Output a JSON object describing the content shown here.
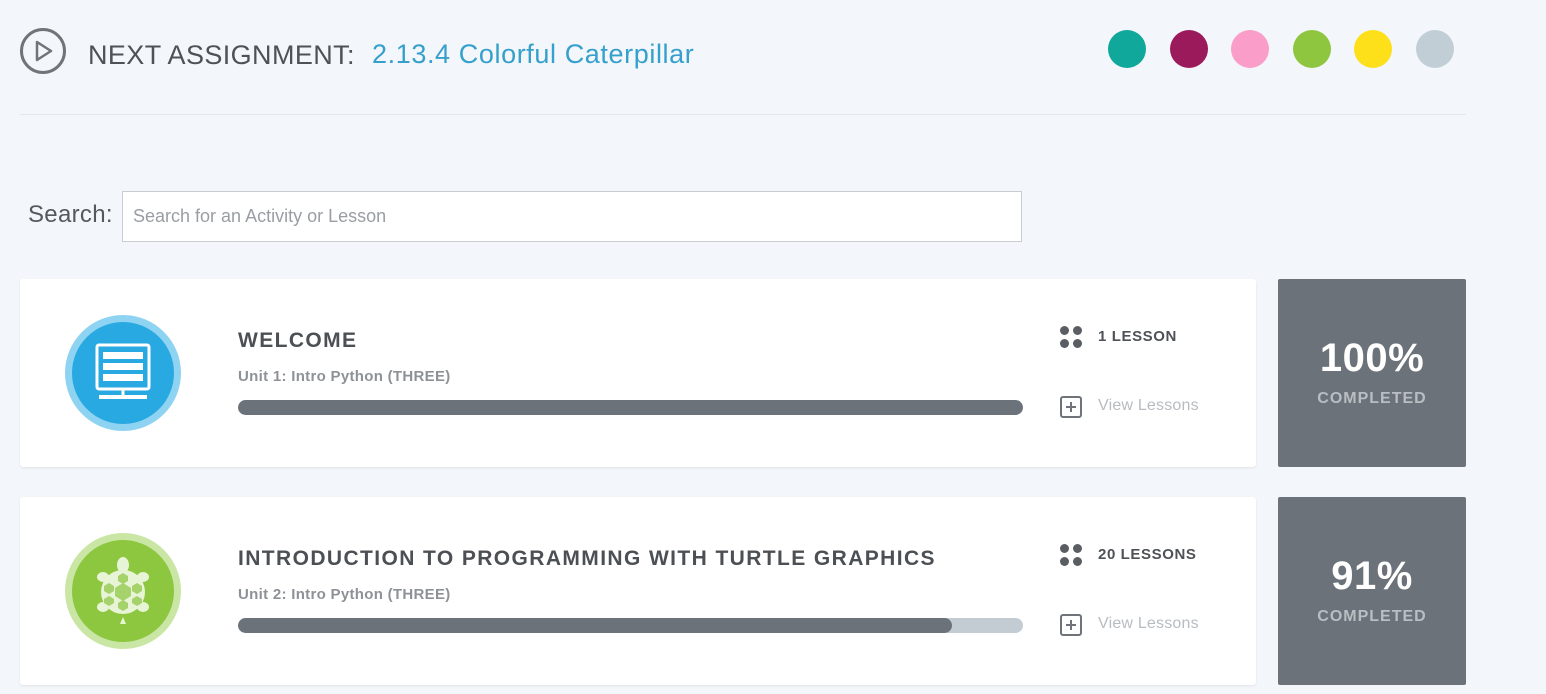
{
  "header": {
    "next_label": "NEXT ASSIGNMENT:",
    "next_assignment": "2.13.4 Colorful Caterpillar",
    "play_icon": "play-circle-icon"
  },
  "color_swatches": [
    {
      "name": "teal",
      "color": "#0fa89b"
    },
    {
      "name": "maroon",
      "color": "#9b1a5c"
    },
    {
      "name": "pink",
      "color": "#fa9dc9"
    },
    {
      "name": "green",
      "color": "#8ec63f"
    },
    {
      "name": "yellow",
      "color": "#fddf1a"
    },
    {
      "name": "gray",
      "color": "#c1ced6"
    }
  ],
  "search": {
    "label": "Search:",
    "placeholder": "Search for an Activity or Lesson",
    "value": ""
  },
  "units": [
    {
      "title": "WELCOME",
      "subtitle": "Unit 1: Intro Python (THREE)",
      "lesson_count": "1 LESSON",
      "view_label": "View Lessons",
      "progress": 1.0,
      "percent": "100%",
      "completed_label": "COMPLETED",
      "icon": "computer-monitor-icon",
      "icon_color": "#29a9e1",
      "icon_ring": "#8fd3f2"
    },
    {
      "title": "INTRODUCTION TO PROGRAMMING WITH TURTLE GRAPHICS",
      "subtitle": "Unit 2: Intro Python (THREE)",
      "lesson_count": "20 LESSONS",
      "view_label": "View Lessons",
      "progress": 0.91,
      "percent": "91%",
      "completed_label": "COMPLETED",
      "icon": "turtle-icon",
      "icon_color": "#8dc63f",
      "icon_ring": "#c9e6a4"
    }
  ]
}
